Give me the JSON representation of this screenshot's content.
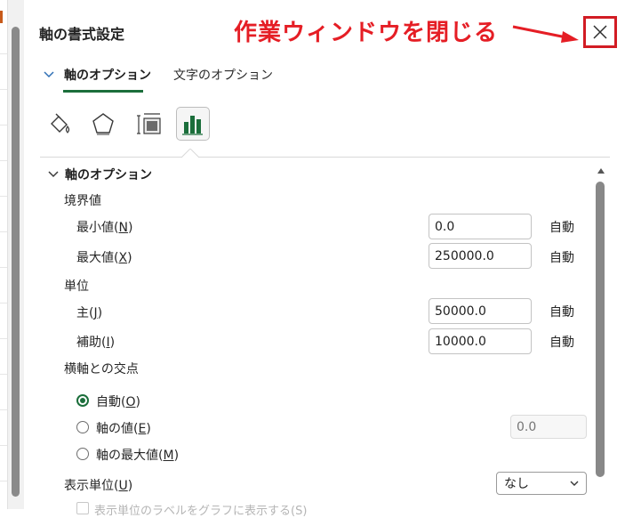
{
  "panel": {
    "title": "軸の書式設定",
    "annotation": "作業ウィンドウを閉じる",
    "tabs": [
      {
        "label": "軸のオプション",
        "selected": true
      },
      {
        "label": "文字のオプション",
        "selected": false
      }
    ],
    "icons": [
      "fill-line-icon",
      "effects-icon",
      "size-properties-icon",
      "axis-options-bar-chart-icon"
    ]
  },
  "axis_options": {
    "section_title": "軸のオプション",
    "bounds": {
      "heading": "境界値",
      "min": {
        "label": "最小値(",
        "key": "N",
        "value": "0.0",
        "auto": "自動"
      },
      "max": {
        "label": "最大値(",
        "key": "X",
        "value": "250000.0",
        "auto": "自動"
      }
    },
    "units": {
      "heading": "単位",
      "major": {
        "label": "主(",
        "key": "J",
        "value": "50000.0",
        "auto": "自動"
      },
      "minor": {
        "label": "補助(",
        "key": "I",
        "value": "10000.0",
        "auto": "自動"
      }
    },
    "crosses": {
      "heading": "横軸との交点",
      "options": [
        {
          "label": "自動(",
          "key": "O",
          "checked": true
        },
        {
          "label": "軸の値(",
          "key": "E",
          "checked": false
        },
        {
          "label": "軸の最大値(",
          "key": "M",
          "checked": false
        }
      ],
      "axis_value_placeholder": "0.0"
    },
    "display_units": {
      "label": "表示単位(",
      "key": "U",
      "value": "なし"
    },
    "show_label_cutoff": "表示単位のラベルをグラフに表示する(S)"
  },
  "colors": {
    "accent": "#1b6e3b",
    "annotation": "#e51e25"
  }
}
